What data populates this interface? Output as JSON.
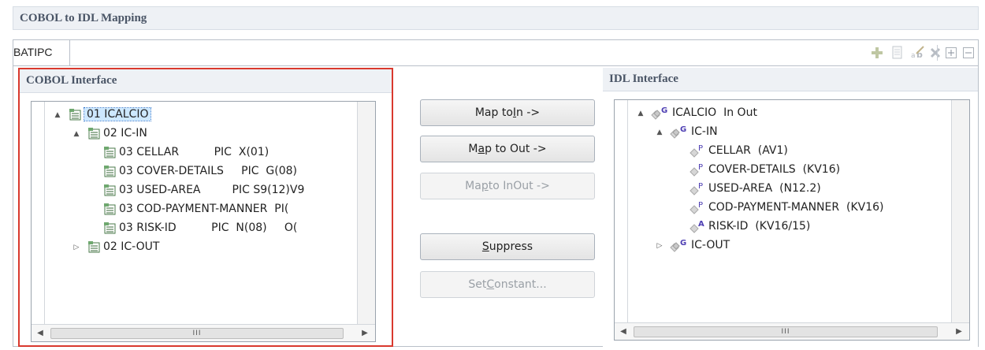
{
  "window": {
    "title": "COBOL to IDL Mapping"
  },
  "tab": {
    "label": "BATIPC"
  },
  "toolbar": {
    "icons": [
      "add-icon",
      "copy-icon",
      "rename-icon",
      "delete-icon",
      "expand-all-icon",
      "collapse-all-icon"
    ]
  },
  "cobol": {
    "title": "COBOL Interface",
    "rows": [
      {
        "text": "01 ICALCIO",
        "twisty": "▲",
        "selected": true
      },
      {
        "text": "02 IC-IN",
        "twisty": "▲"
      },
      {
        "text": "03 CELLAR          PIC  X(01)"
      },
      {
        "text": "03 COVER-DETAILS     PIC  G(08)"
      },
      {
        "text": "03 USED-AREA         PIC S9(12)V9"
      },
      {
        "text": "03 COD-PAYMENT-MANNER  PI("
      },
      {
        "text": "03 RISK-ID          PIC  N(08)     O("
      },
      {
        "text": "02 IC-OUT",
        "twisty": "▷"
      }
    ]
  },
  "buttons": {
    "map_in": {
      "pre": "Map to ",
      "mnemonic": "I",
      "post": "n ->"
    },
    "map_out": {
      "pre": "M",
      "mnemonic": "a",
      "post": "p to Out ->"
    },
    "map_inout": {
      "pre": "Ma",
      "mnemonic": "p",
      "post": " to InOut ->"
    },
    "suppress": {
      "pre": "",
      "mnemonic": "S",
      "post": "uppress"
    },
    "set_constant": {
      "pre": "Set ",
      "mnemonic": "C",
      "post": "onstant..."
    }
  },
  "idl": {
    "title": "IDL Interface",
    "rows": [
      {
        "text": "ICALCIO  In Out",
        "badge": "G",
        "twisty": "▲"
      },
      {
        "text": "IC-IN",
        "badge": "G",
        "twisty": "▲"
      },
      {
        "text": "CELLAR  (AV1)",
        "badge": "P"
      },
      {
        "text": "COVER-DETAILS  (KV16)",
        "badge": "P"
      },
      {
        "text": "USED-AREA  (N12.2)",
        "badge": "P"
      },
      {
        "text": "COD-PAYMENT-MANNER  (KV16)",
        "badge": "P"
      },
      {
        "text": "RISK-ID  (KV16/15)",
        "badge": "A"
      },
      {
        "text": "IC-OUT",
        "badge": "G",
        "twisty": "▷"
      }
    ]
  },
  "colors": {
    "accent": "#d9392e",
    "selection": "#cde8ff",
    "header_text": "#4a5566"
  }
}
